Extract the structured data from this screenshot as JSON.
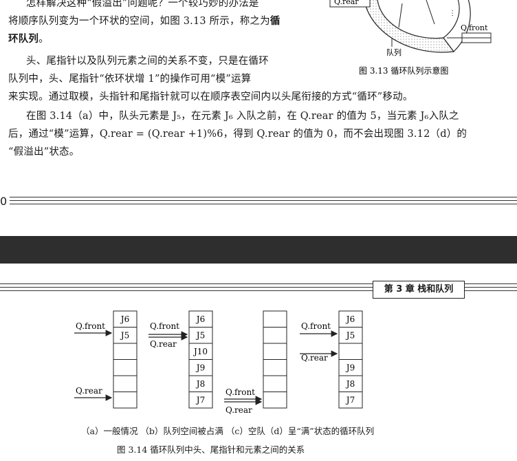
{
  "top_text": {
    "line1": "怎样解决这种“假溢出”问题呢？一个较巧妙的办法是",
    "line2a": "将顺序队列变为一个环状的空间，如图 3.13 所示，称之为",
    "line2b": "循",
    "line3": "环队列",
    "line3end": "。",
    "line4": "头、尾指针以及队列元素之间的关系不变，只是在循环",
    "line5": "队列中，头、尾指针“依环状增 1”的操作可用“模”运算",
    "line6": "来实现。通过取模，头指针和尾指针就可以在顺序表空间内以头尾衔接的方式“循环”移动。",
    "line7": "在图 3.14（a）中，队头元素是 J₅，在元素 J₆ 入队之前，在 Q.rear 的值为 5，当元素 J₆入队之",
    "line8": "后，通过“模”运算，Q.rear = (Q.rear +1)%6，得到 Q.rear 的值为 0，而不会出现图 3.12（d）的",
    "line9": "“假溢出”状态。"
  },
  "fig313": {
    "label_rear": "Q.rear",
    "label_front": "Q.front",
    "label_queue": "队列",
    "caption": "图 3.13   循环队列示意图"
  },
  "page_number": "0",
  "chapter": "第 3 章   栈和队列",
  "fig314": {
    "a": {
      "cells": [
        "J6",
        "J5",
        "",
        "",
        "",
        ""
      ],
      "front": "Q.front",
      "rear": "Q.rear"
    },
    "b": {
      "cells": [
        "J6",
        "J5",
        "J10",
        "J9",
        "J8",
        "J7"
      ],
      "front": "Q.front",
      "rear": "Q.rear"
    },
    "c": {
      "cells": [
        "",
        "",
        "",
        "",
        "",
        ""
      ],
      "front": "Q.front",
      "rear": "Q.rear"
    },
    "d": {
      "cells": [
        "J6",
        "J5",
        "",
        "J9",
        "J8",
        "J7"
      ],
      "front": "Q.front",
      "rear": "Q.rear"
    },
    "subcaption": "（a）一般情况   （b）队列空间被占满   （c）空队（d）呈“满”状态的循环队列",
    "caption": "图 3.14   循环队列中头、尾指针和元素之间的关系"
  }
}
